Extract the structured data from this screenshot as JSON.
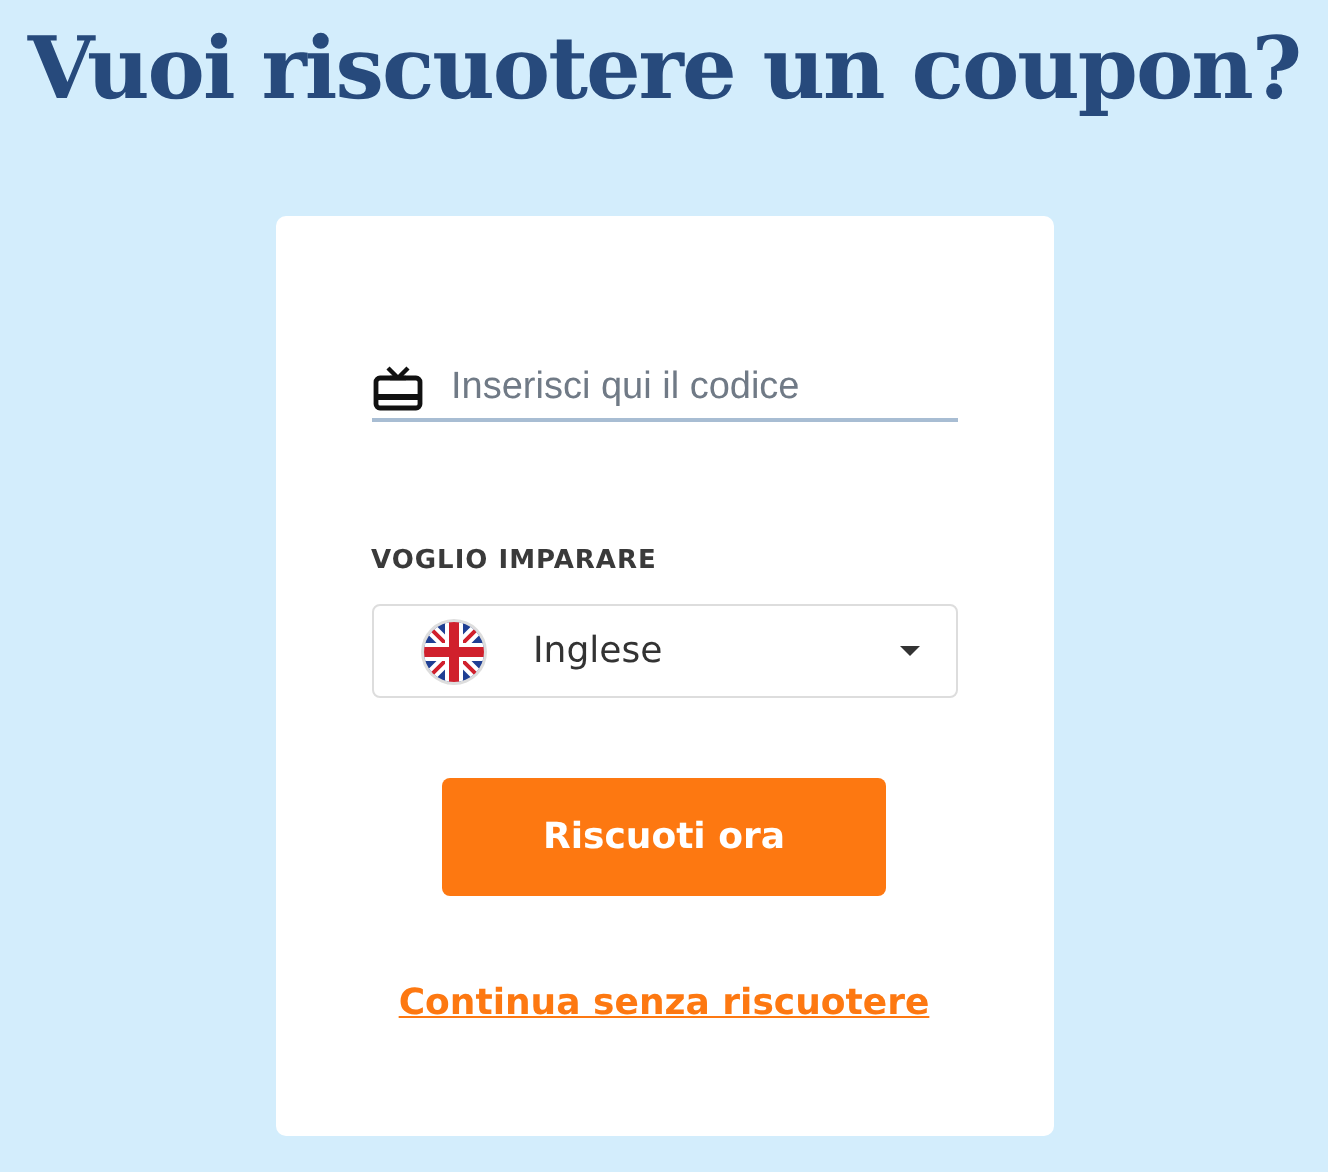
{
  "title": "Vuoi riscuotere un coupon?",
  "code_field": {
    "placeholder": "Inserisci qui il codice"
  },
  "language": {
    "label": "VOGLIO IMPARARE",
    "value": "Inglese"
  },
  "submit_button": "Riscuoti ora",
  "skip_link": "Continua senza riscuotere"
}
